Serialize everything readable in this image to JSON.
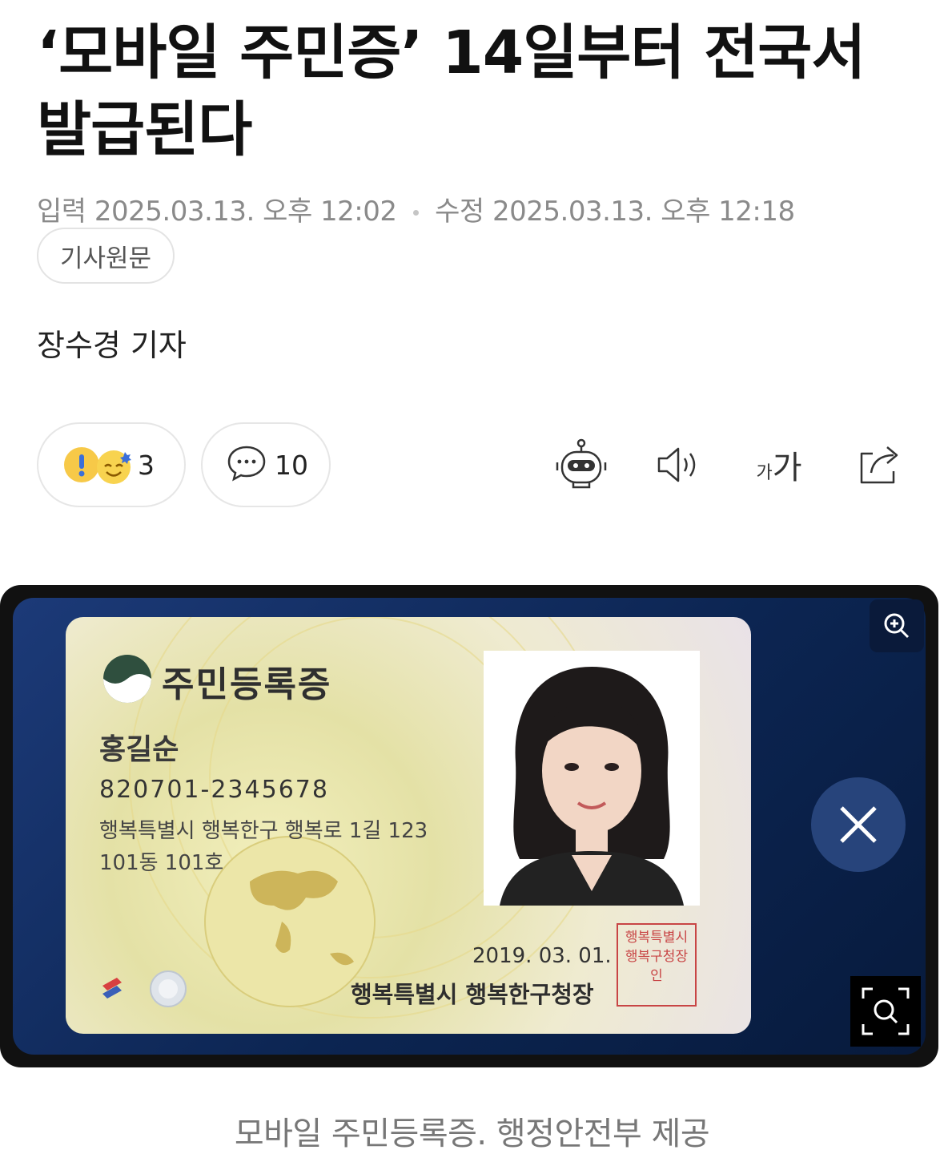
{
  "article": {
    "headline": "‘모바일 주민증’ 14일부터 전국서 발급된다",
    "input_label": "입력",
    "input_datetime": "2025.03.13. 오후 12:02",
    "modified_label": "수정",
    "modified_datetime": "2025.03.13. 오후 12:18",
    "source_button": "기사원문",
    "reporter": "장수경 기자"
  },
  "reactions": {
    "count": "3",
    "comment_count": "10"
  },
  "toolbar": {
    "icons": [
      "ai-summary-robot-icon",
      "text-to-speech-icon",
      "font-size-icon",
      "share-icon"
    ],
    "font_size_small": "가",
    "font_size_large": "가"
  },
  "figure": {
    "card": {
      "title": "주민등록증",
      "name": "홍길순",
      "id_number": "820701-2345678",
      "address_line1": "행복특별시 행복한구 행복로 1길 123",
      "address_line2": "101동 101호",
      "issue_date": "2019. 03. 01.",
      "issuer": "행복특별시 행복한구청장",
      "stamp_text": "행복특별시 행복구청장인"
    },
    "caption": "모바일 주민등록증. 행정안전부 제공"
  },
  "colors": {
    "meta_gray": "#8a8a8a",
    "figure_blue": "#0c2552",
    "stamp_red": "#c84545"
  }
}
